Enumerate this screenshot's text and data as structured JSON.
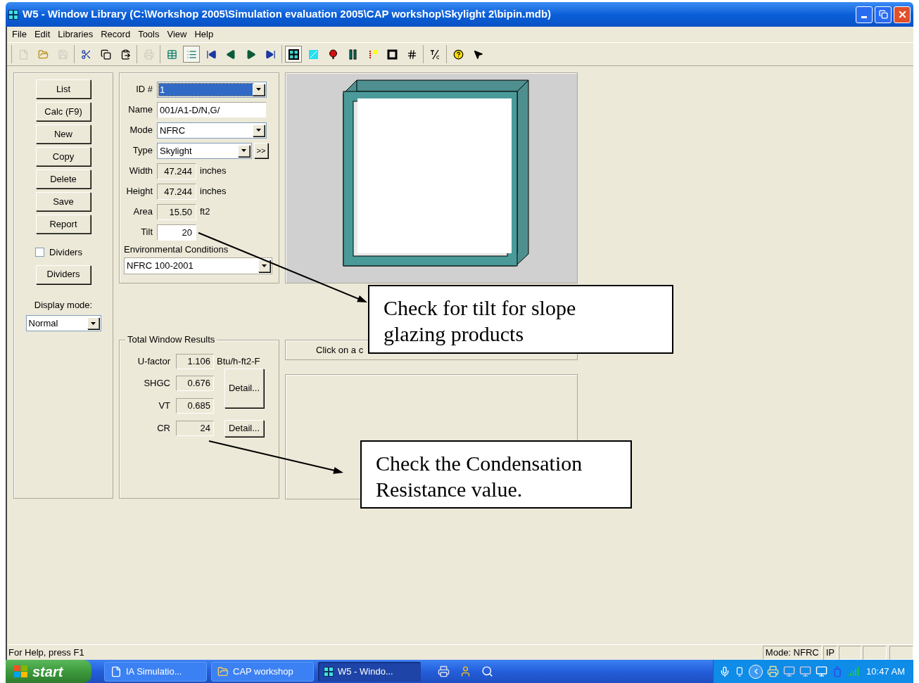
{
  "window": {
    "title": "W5 - Window Library (C:\\Workshop 2005\\Simulation evaluation 2005\\CAP workshop\\Skylight 2\\bipin.mdb)"
  },
  "menu": [
    "File",
    "Edit",
    "Libraries",
    "Record",
    "Tools",
    "View",
    "Help"
  ],
  "toolbar": [
    [
      {
        "kind": "new",
        "pressed": false,
        "disabled": true
      },
      {
        "kind": "open",
        "pressed": false,
        "disabled": false
      },
      {
        "kind": "save",
        "pressed": false,
        "disabled": true
      }
    ],
    [
      {
        "kind": "cut",
        "pressed": false,
        "disabled": false
      },
      {
        "kind": "copy",
        "pressed": false,
        "disabled": false
      },
      {
        "kind": "paste",
        "pressed": false,
        "disabled": false
      }
    ],
    [
      {
        "kind": "print",
        "pressed": false,
        "disabled": true
      }
    ],
    [
      {
        "kind": "table",
        "pressed": false,
        "disabled": false
      },
      {
        "kind": "list",
        "pressed": true,
        "disabled": false
      },
      {
        "kind": "first",
        "pressed": false,
        "disabled": false
      },
      {
        "kind": "prev",
        "pressed": false,
        "disabled": false
      },
      {
        "kind": "next",
        "pressed": false,
        "disabled": false
      },
      {
        "kind": "last",
        "pressed": false,
        "disabled": false
      }
    ],
    [
      {
        "kind": "grid",
        "pressed": true,
        "disabled": false
      },
      {
        "kind": "glass",
        "pressed": false,
        "disabled": false
      },
      {
        "kind": "balloon",
        "pressed": false,
        "disabled": false
      },
      {
        "kind": "bars",
        "pressed": false,
        "disabled": false
      },
      {
        "kind": "thermo",
        "pressed": false,
        "disabled": false
      },
      {
        "kind": "frame",
        "pressed": false,
        "disabled": false
      },
      {
        "kind": "hash",
        "pressed": false,
        "disabled": false
      }
    ],
    [
      {
        "kind": "units",
        "pressed": false,
        "disabled": false
      }
    ],
    [
      {
        "kind": "help",
        "pressed": false,
        "disabled": false
      },
      {
        "kind": "whatsthis",
        "pressed": false,
        "disabled": false
      }
    ]
  ],
  "left_panel": {
    "buttons": [
      {
        "label": "List"
      },
      {
        "label": "Calc (F9)"
      },
      {
        "label": "New"
      },
      {
        "label": "Copy"
      },
      {
        "label": "Delete"
      },
      {
        "label": "Save"
      },
      {
        "label": "Report"
      }
    ],
    "dividers_checkbox": {
      "label": "Dividers",
      "checked": false
    },
    "dividers_button": {
      "label": "Dividers"
    },
    "display_mode": {
      "label": "Display mode:",
      "value": "Normal"
    }
  },
  "fields": [
    {
      "kind": "dropdown",
      "label": "ID #",
      "value": "1",
      "focused": true
    },
    {
      "kind": "input",
      "label": "Name",
      "value": "001/A1-D/N,G/"
    },
    {
      "kind": "dropdown",
      "label": "Mode",
      "value": "NFRC",
      "focused": false
    },
    {
      "kind": "dropdown",
      "label": "Type",
      "value": "Skylight",
      "focused": false,
      "more": ">>"
    },
    {
      "kind": "readonly",
      "label": "Width",
      "value": "47.244",
      "unit": "inches"
    },
    {
      "kind": "readonly",
      "label": "Height",
      "value": "47.244",
      "unit": "inches"
    },
    {
      "kind": "readonly",
      "label": "Area",
      "value": "15.50",
      "unit": "ft2"
    },
    {
      "kind": "number",
      "label": "Tilt",
      "value": "20"
    }
  ],
  "environmental_conditions": {
    "label": "Environmental Conditions",
    "value": "NFRC 100-2001"
  },
  "results": {
    "title": "Total Window Results",
    "rows": [
      {
        "label": "U-factor",
        "value": "1.106",
        "unit": "Btu/h-ft2-F"
      },
      {
        "label": "SHGC",
        "value": "0.676"
      },
      {
        "label": "VT",
        "value": "0.685"
      },
      {
        "label": "CR",
        "value": "24"
      }
    ],
    "detail_buttons": [
      "Detail...",
      "Detail..."
    ]
  },
  "component_hint": "Click on a c",
  "callouts": [
    "Check for tilt for slope glazing products",
    "Check the Condensation Resistance value."
  ],
  "status_bar": {
    "help": "For Help, press F1",
    "panes": [
      "Mode: NFRC",
      "IP"
    ]
  },
  "taskbar": {
    "start": "start",
    "tasks": [
      {
        "kind": "document",
        "label": "IA Simulatio...",
        "selected": false
      },
      {
        "kind": "folder",
        "label": "CAP workshop",
        "selected": false
      },
      {
        "kind": "app",
        "label": "W5 - Windo...",
        "selected": true
      }
    ],
    "clock": "10:47 AM"
  }
}
